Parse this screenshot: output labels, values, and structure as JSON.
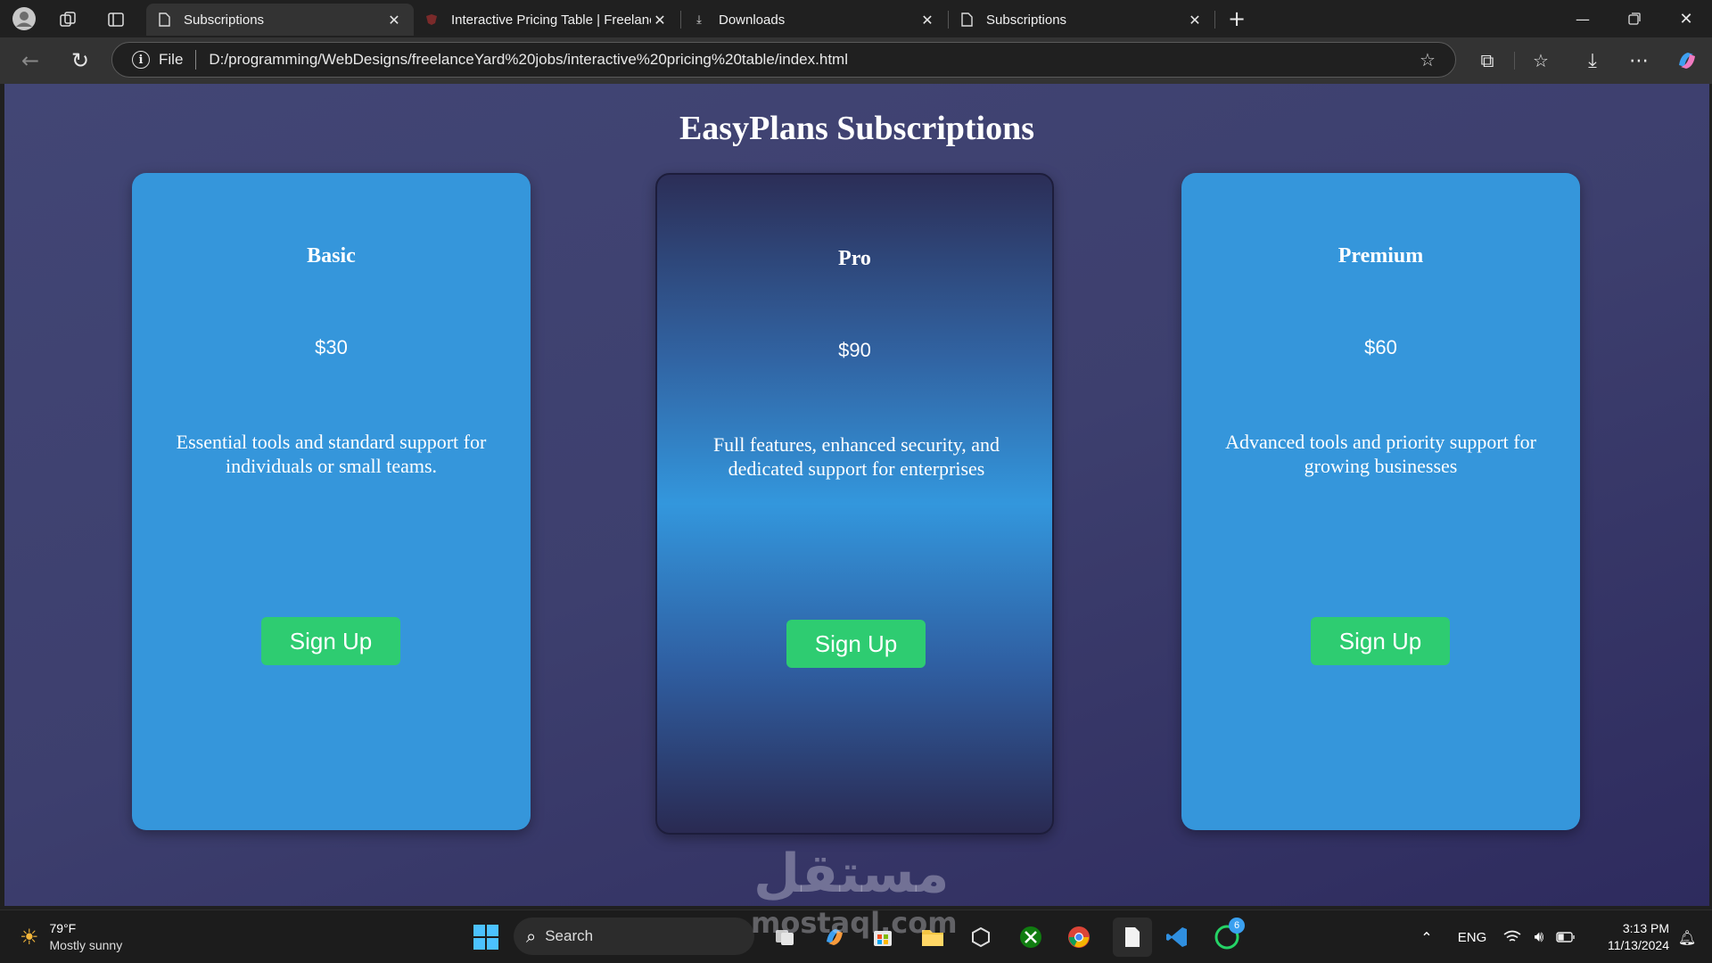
{
  "browser": {
    "tabs": [
      {
        "title": "Subscriptions",
        "active": true,
        "favicon": "page-icon"
      },
      {
        "title": "Interactive Pricing Table | Freelanc",
        "active": false,
        "favicon": "site-icon"
      },
      {
        "title": "Downloads",
        "active": false,
        "favicon": "download-icon"
      },
      {
        "title": "Subscriptions",
        "active": false,
        "favicon": "page-icon"
      }
    ],
    "address": {
      "scheme_label": "File",
      "url": "D:/programming/WebDesigns/freelanceYard%20jobs/interactive%20pricing%20table/index.html"
    }
  },
  "page": {
    "title": "EasyPlans Subscriptions",
    "plans": [
      {
        "name": "Basic",
        "price": "$30",
        "description": "Essential tools and standard support for individuals or small teams.",
        "cta": "Sign Up"
      },
      {
        "name": "Pro",
        "price": "$90",
        "description": "Full features, enhanced security, and dedicated support for enterprises",
        "cta": "Sign Up"
      },
      {
        "name": "Premium",
        "price": "$60",
        "description": "Advanced tools and priority support for growing businesses",
        "cta": "Sign Up"
      }
    ],
    "colors": {
      "card_blue": "#3596db",
      "button_green": "#2ecc71",
      "background": "#3d3f6e"
    }
  },
  "taskbar": {
    "weather": {
      "temp": "79°F",
      "condition": "Mostly sunny"
    },
    "search_label": "Search",
    "language": "ENG",
    "time": "3:13 PM",
    "date": "11/13/2024",
    "whatsapp_badge": "6"
  },
  "watermark": {
    "arabic": "مستقل",
    "latin": "mostaql.com"
  }
}
